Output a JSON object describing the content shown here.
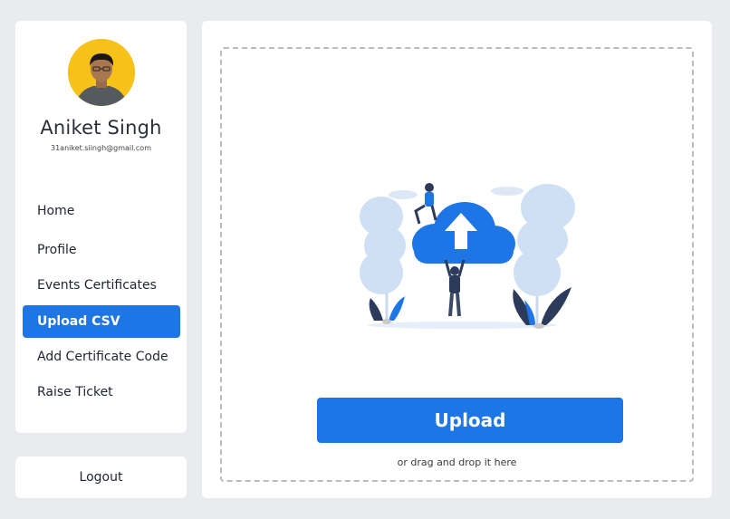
{
  "profile": {
    "name": "Aniket Singh",
    "email": "31aniket.siingh@gmail.com"
  },
  "nav": {
    "items": [
      {
        "label": "Home"
      },
      {
        "label": "Profile"
      },
      {
        "label": "Events Certificates"
      },
      {
        "label": "Upload CSV",
        "active": true
      },
      {
        "label": "Add Certificate Code"
      },
      {
        "label": "Raise Ticket"
      }
    ]
  },
  "logout_label": "Logout",
  "upload": {
    "button_label": "Upload",
    "hint": "or drag and drop it here"
  },
  "colors": {
    "accent": "#1e76e6",
    "avatar_bg": "#f6c21a",
    "page_bg": "#e9ebee"
  }
}
